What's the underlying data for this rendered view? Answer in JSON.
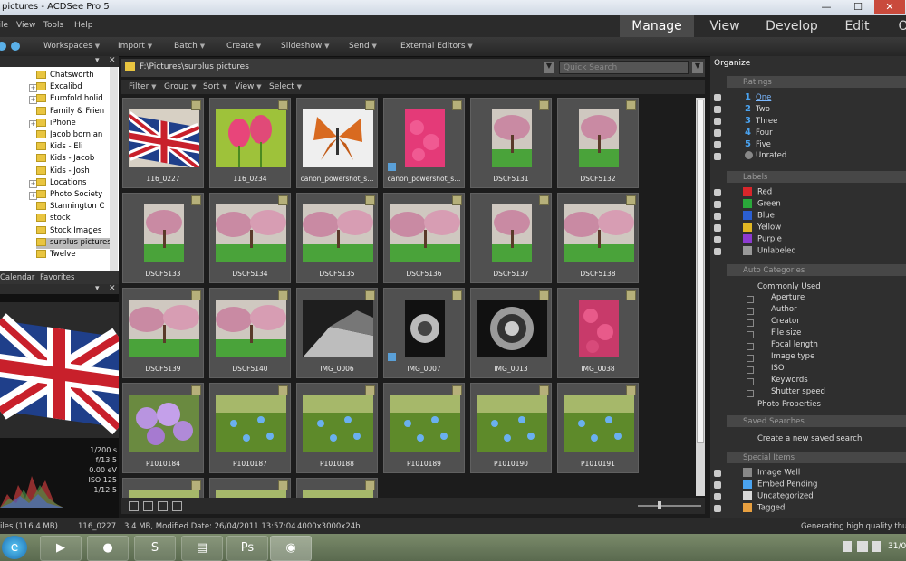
{
  "window": {
    "title": "pictures - ACDSee Pro 5",
    "minimize": "—",
    "maximize": "☐",
    "close": "✕"
  },
  "menu": [
    "File",
    "View",
    "Tools",
    "Help"
  ],
  "modes": [
    "Manage",
    "View",
    "Develop",
    "Edit",
    "O"
  ],
  "toolbar": [
    "Workspaces",
    "Import",
    "Batch",
    "Create",
    "Slideshow",
    "Send",
    "External Editors"
  ],
  "folders": [
    {
      "label": "Chatsworth",
      "expander": ""
    },
    {
      "label": "Excalibd",
      "expander": "+"
    },
    {
      "label": "Eurofold holid",
      "expander": "+"
    },
    {
      "label": "Family & Frien",
      "expander": ""
    },
    {
      "label": "iPhone",
      "expander": "+"
    },
    {
      "label": "Jacob born an",
      "expander": ""
    },
    {
      "label": "Kids - Eli",
      "expander": ""
    },
    {
      "label": "Kids - Jacob",
      "expander": ""
    },
    {
      "label": "Kids - Josh",
      "expander": ""
    },
    {
      "label": "Locations",
      "expander": "+"
    },
    {
      "label": "Photo Society",
      "expander": "+"
    },
    {
      "label": "Stannington C",
      "expander": ""
    },
    {
      "label": "stock",
      "expander": ""
    },
    {
      "label": "Stock Images",
      "expander": ""
    },
    {
      "label": "surplus pictures",
      "expander": "",
      "selected": true
    },
    {
      "label": "Twelve",
      "expander": ""
    }
  ],
  "left_tabs": [
    "Calendar",
    "Favorites"
  ],
  "preview_info": [
    "1/200 s",
    "f/13.5",
    "0.00 eV",
    "ISO 125",
    "1/12.5"
  ],
  "path": "F:\\Pictures\\surplus pictures",
  "quick_search_placeholder": "Quick Search",
  "filters": [
    "Filter",
    "Group",
    "Sort",
    "View",
    "Select"
  ],
  "thumbnails": [
    {
      "name": "116_0227",
      "img": "flag"
    },
    {
      "name": "116_0234",
      "img": "tulips"
    },
    {
      "name": "canon_powershot_s...",
      "img": "butterfly"
    },
    {
      "name": "canon_powershot_s...",
      "img": "pink",
      "blue": true
    },
    {
      "name": "DSCF5131",
      "img": "blossom-v"
    },
    {
      "name": "DSCF5132",
      "img": "blossom-v"
    },
    {
      "name": "DSCF5133",
      "img": "blossom-v"
    },
    {
      "name": "DSCF5134",
      "img": "blossom"
    },
    {
      "name": "DSCF5135",
      "img": "blossom"
    },
    {
      "name": "DSCF5136",
      "img": "blossom"
    },
    {
      "name": "DSCF5137",
      "img": "blossom-v"
    },
    {
      "name": "DSCF5138",
      "img": "blossom"
    },
    {
      "name": "DSCF5139",
      "img": "blossom"
    },
    {
      "name": "DSCF5140",
      "img": "blossom"
    },
    {
      "name": "IMG_0006",
      "img": "bw"
    },
    {
      "name": "IMG_0007",
      "img": "bw-v",
      "blue": true
    },
    {
      "name": "IMG_0013",
      "img": "lens"
    },
    {
      "name": "IMG_0038",
      "img": "pink-v"
    },
    {
      "name": "P1010184",
      "img": "purple"
    },
    {
      "name": "P1010187",
      "img": "green"
    },
    {
      "name": "P1010188",
      "img": "green"
    },
    {
      "name": "P1010189",
      "img": "green"
    },
    {
      "name": "P1010190",
      "img": "green"
    },
    {
      "name": "P1010191",
      "img": "green"
    },
    {
      "name": "",
      "img": "green"
    },
    {
      "name": "",
      "img": "green"
    },
    {
      "name": "",
      "img": "green"
    }
  ],
  "organize": {
    "title": "Organize",
    "sections": {
      "ratings": "Ratings",
      "labels": "Labels",
      "auto_categories": "Auto Categories",
      "saved_searches": "Saved Searches",
      "special_items": "Special Items"
    },
    "ratings": [
      {
        "num": "1",
        "label": "One"
      },
      {
        "num": "2",
        "label": "Two"
      },
      {
        "num": "3",
        "label": "Three"
      },
      {
        "num": "4",
        "label": "Four"
      },
      {
        "num": "5",
        "label": "Five"
      },
      {
        "num": "",
        "label": "Unrated"
      }
    ],
    "labels": [
      {
        "label": "Red",
        "color": "#d8262b"
      },
      {
        "label": "Green",
        "color": "#2aa83a"
      },
      {
        "label": "Blue",
        "color": "#2b5fd1"
      },
      {
        "label": "Yellow",
        "color": "#e2b824"
      },
      {
        "label": "Purple",
        "color": "#8d3ad1"
      },
      {
        "label": "Unlabeled",
        "color": "#999999"
      }
    ],
    "commonly_used": "Commonly Used",
    "auto_items": [
      "Aperture",
      "Author",
      "Creator",
      "File size",
      "Focal length",
      "Image type",
      "ISO",
      "Keywords",
      "Shutter speed"
    ],
    "photo_properties": "Photo Properties",
    "create_saved_search": "Create a new saved search",
    "special": [
      "Image Well",
      "Embed Pending",
      "Uncategorized",
      "Tagged"
    ]
  },
  "status": {
    "left": "iles (116.4 MB)",
    "file": "116_0227",
    "info": "3.4 MB, Modified Date: 26/04/2011 13:57:04",
    "dims": "4000x3000x24b",
    "right": "Generating high quality thumbn"
  },
  "taskbar": {
    "clock": "31/0"
  }
}
